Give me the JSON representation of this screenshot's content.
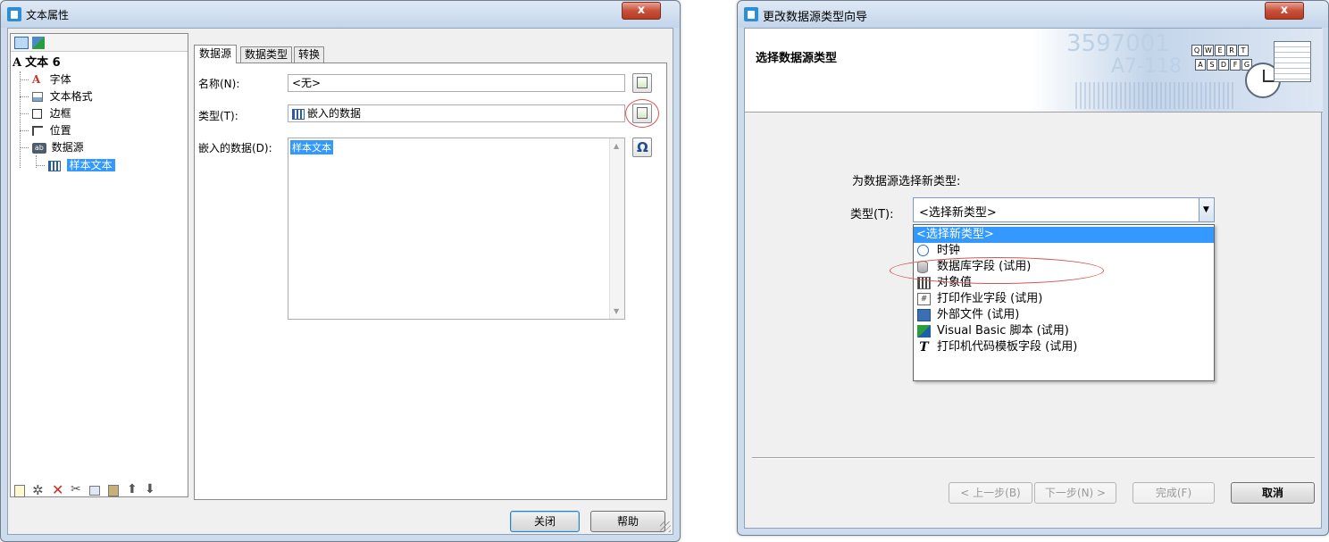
{
  "left_window": {
    "title": "文本属性",
    "close_glyph": "x",
    "tree": {
      "root_icon": "A",
      "root": "文本 6",
      "items": [
        {
          "label": "字体",
          "icon": "font-icon"
        },
        {
          "label": "文本格式",
          "icon": "text-format-icon"
        },
        {
          "label": "边框",
          "icon": "border-icon"
        },
        {
          "label": "位置",
          "icon": "position-icon"
        },
        {
          "label": "数据源",
          "icon": "datasource-icon"
        }
      ],
      "selected_child": "样本文本"
    },
    "tabs": [
      "数据源",
      "数据类型",
      "转换"
    ],
    "form": {
      "name_label": "名称(N):",
      "name_value": "<无>",
      "type_label": "类型(T):",
      "type_value": "嵌入的数据",
      "embedded_label": "嵌入的数据(D):",
      "embedded_value": "样本文本",
      "omega_glyph": "Ω"
    },
    "buttons": {
      "close": "关闭",
      "help": "帮助"
    }
  },
  "right_window": {
    "title": "更改数据源类型向导",
    "close_glyph": "x",
    "header": {
      "title": "选择数据源类型",
      "banner_numbers": [
        "3597001",
        "A7-118"
      ],
      "keys_row1": [
        "Q",
        "W",
        "E",
        "R",
        "T"
      ],
      "keys_row2": [
        "A",
        "S",
        "D",
        "F",
        "G"
      ]
    },
    "prompt": "为数据源选择新类型:",
    "type_label": "类型(T):",
    "type_value": "<选择新类型>",
    "dropdown_options": [
      {
        "label": "<选择新类型>",
        "icon": "",
        "selected": true
      },
      {
        "label": "时钟",
        "icon": "clock-icon"
      },
      {
        "label": "数据库字段 (试用)",
        "icon": "database-icon"
      },
      {
        "label": "对象值",
        "icon": "object-value-icon"
      },
      {
        "label": "打印作业字段 (试用)",
        "icon": "print-job-icon"
      },
      {
        "label": "外部文件 (试用)",
        "icon": "floppy-disk-icon"
      },
      {
        "label": "Visual Basic 脚本 (试用)",
        "icon": "vb-script-icon"
      },
      {
        "label": "打印机代码模板字段 (试用)",
        "icon": "printer-code-icon"
      }
    ],
    "buttons": {
      "back": "< 上一步(B)",
      "next": "下一步(N) >",
      "finish": "完成(F)",
      "cancel": "取消"
    }
  },
  "colors": {
    "selection": "#3399ff",
    "highlight_circle": "#d9534f",
    "accent": "#2a8fd6"
  }
}
